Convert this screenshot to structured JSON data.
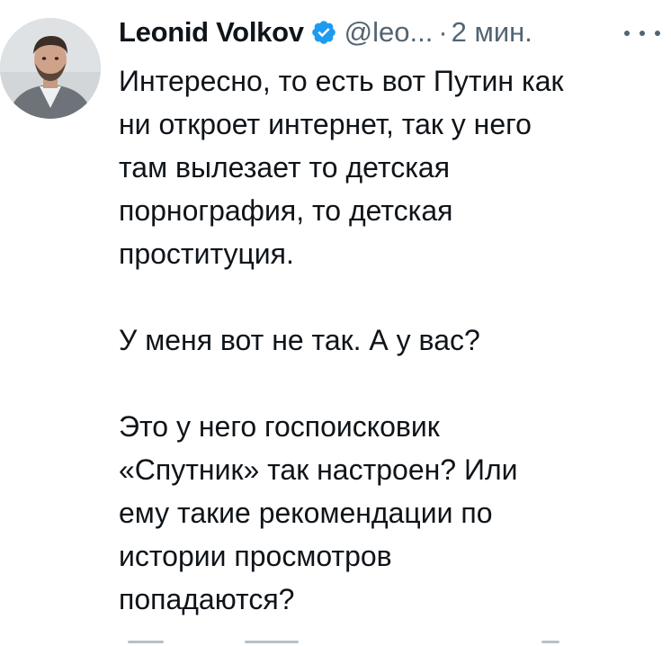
{
  "author": {
    "name": "Leonid Volkov",
    "handle": "@leo...",
    "separator": "·",
    "time": "2 мин."
  },
  "colors": {
    "verified_badge": "#1d9bf0",
    "secondary_text": "#536471",
    "primary_text": "#0f1419"
  },
  "icons": {
    "verified": "verified-badge-icon",
    "more": "more-options-icon"
  },
  "tweet": {
    "paragraphs": [
      {
        "lines": [
          "Интересно, то есть вот Путин как",
          "ни откроет интернет, так у него",
          "там вылезает то детская",
          "порнография, то детская",
          "проституция."
        ]
      },
      {
        "lines": [
          "У меня вот не так. А у вас?"
        ]
      },
      {
        "lines": [
          "Это у него госпоисковик",
          "«Спутник» так настроен? Или",
          "ему такие рекомендации по",
          "истории просмотров",
          "попадаются?"
        ]
      }
    ]
  }
}
